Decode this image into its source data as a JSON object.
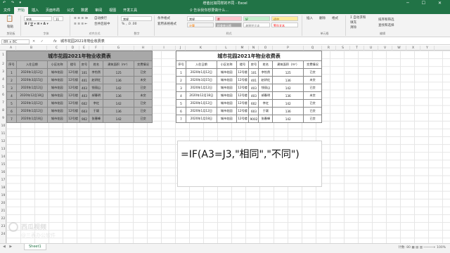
{
  "window": {
    "title": "增值比如同样的不同 - Excel",
    "qat_icons": "↶ ↷ ▾",
    "controls": "─ ☐ ✕"
  },
  "menu": {
    "tabs": [
      "文件",
      "开始",
      "插入",
      "页面布局",
      "公式",
      "数据",
      "审阅",
      "视图",
      "开发工具"
    ],
    "active_index": 1,
    "search_placeholder": "♀ 告诉我你想要做什么..."
  },
  "ribbon": {
    "paste": "粘贴",
    "clipboard": "剪贴板",
    "font_name": "宋体",
    "font_size": "11",
    "font_group": "字体",
    "align_group": "对齐方式",
    "wrap": "自动换行",
    "merge": "合并后居中",
    "number_format": "常规",
    "number_group": "数字",
    "cond_format": "条件格式",
    "table_format": "套用表格格式",
    "styles_group": "样式",
    "style_normal": "常规",
    "style_bad": "差",
    "style_good": "好",
    "style_neutral": "适中",
    "style_calc": "计算",
    "style_check": "检查单元格",
    "style_explain": "解释性文本",
    "style_warn": "警告文本",
    "style_link": "链接单元格",
    "insert": "插入",
    "delete": "删除",
    "format": "格式",
    "cells_group": "单元格",
    "sum": "Σ 自动求和",
    "fill": "填充",
    "clear": "清除",
    "sort": "排序和筛选",
    "find": "查找和选择",
    "edit_group": "编辑"
  },
  "formula_bar": {
    "name_box": "8R x 8C",
    "icons": "✕ ✓",
    "fx": "fx",
    "content": "城市花园2021年物业收费表"
  },
  "columns": [
    "A",
    "B",
    "C",
    "D",
    "E",
    "F",
    "G",
    "H",
    "I",
    "J",
    "K",
    "L",
    "M",
    "N",
    "O",
    "P",
    "Q",
    "R",
    "S",
    "T",
    "U",
    "V",
    "W",
    "X",
    "Y"
  ],
  "rows": [
    "1",
    "2",
    "3",
    "4",
    "5",
    "6",
    "7",
    "8",
    "9",
    "10",
    "11",
    "12",
    "13",
    "14",
    "15",
    "16",
    "17",
    "18",
    "19",
    "20",
    "21",
    "22",
    "23",
    "24",
    "25"
  ],
  "table_left": {
    "title": "城市花园2021年物业收费表",
    "headers": [
      "序号",
      "入住日期",
      "小区名称",
      "楼号",
      "房号",
      "姓名",
      "建筑面积（m²）",
      "交费情况"
    ],
    "rows": [
      [
        "1",
        "2020年1月12日",
        "城市花园",
        "12号楼",
        "101",
        "李怡然",
        "125",
        "已交"
      ],
      [
        "2",
        "2020年3月15日",
        "城市花园",
        "12号楼",
        "401",
        "赵妍红",
        "136",
        "未交"
      ],
      [
        "3",
        "2020年1月12日",
        "城市花园",
        "12号楼",
        "403",
        "钱丽山",
        "142",
        "已交"
      ],
      [
        "4",
        "2020年12月18日",
        "城市花园",
        "12号楼",
        "403",
        "郝春明",
        "136",
        "未交"
      ],
      [
        "5",
        "2020年1月12日",
        "城市花园",
        "12号楼",
        "602",
        "李红",
        "142",
        "已交"
      ],
      [
        "6",
        "2020年1月12日",
        "城市花园",
        "12号楼",
        "603",
        "于颖",
        "136",
        "已交"
      ],
      [
        "7",
        "2020年1月18日",
        "城市花园",
        "12号楼",
        "902",
        "张春峰",
        "142",
        "已交"
      ]
    ]
  },
  "table_right": {
    "title": "城市花园2021年物业收费表",
    "headers": [
      "序号",
      "入住日期",
      "小区名称",
      "楼号",
      "房号",
      "姓名",
      "建筑面积（m²）",
      "交费情况"
    ],
    "rows": [
      [
        "1",
        "2020年1月12日",
        "城市花园",
        "12号楼",
        "101",
        "李怡然",
        "125",
        "已交"
      ],
      [
        "2",
        "2020年3月15日",
        "城市花园",
        "12号楼",
        "401",
        "赵妍红",
        "136",
        "未交"
      ],
      [
        "3",
        "2020年1月12日",
        "城市花园",
        "12号楼",
        "403",
        "钱丽山",
        "142",
        "已交"
      ],
      [
        "4",
        "2020年12月18日",
        "城市花园",
        "12号楼",
        "403",
        "郝春明",
        "136",
        "未交"
      ],
      [
        "5",
        "2020年1月12日",
        "城市花园",
        "12号楼",
        "602",
        "李红",
        "142",
        "已交"
      ],
      [
        "6",
        "2020年1月12日",
        "城市花园",
        "12号楼",
        "603",
        "于颖",
        "136",
        "已交"
      ],
      [
        "7",
        "2020年1月18日",
        "城市花园",
        "12号楼",
        "9002",
        "张春峰",
        "142",
        "已交"
      ]
    ]
  },
  "formula_overlay": "=IF(A3=J3,\"相同\",\"不同\")",
  "status": {
    "nav": "◀ ▶",
    "sheet": "Sheet1",
    "right": "计数: 80    ▦ ▤ ▥  ─────+  100%"
  },
  "watermark": {
    "line1": "西瓜视频",
    "line2": "@三表办公软件"
  },
  "colors": {
    "excel_green": "#217346",
    "selection_gray": "#b4b4b4"
  }
}
